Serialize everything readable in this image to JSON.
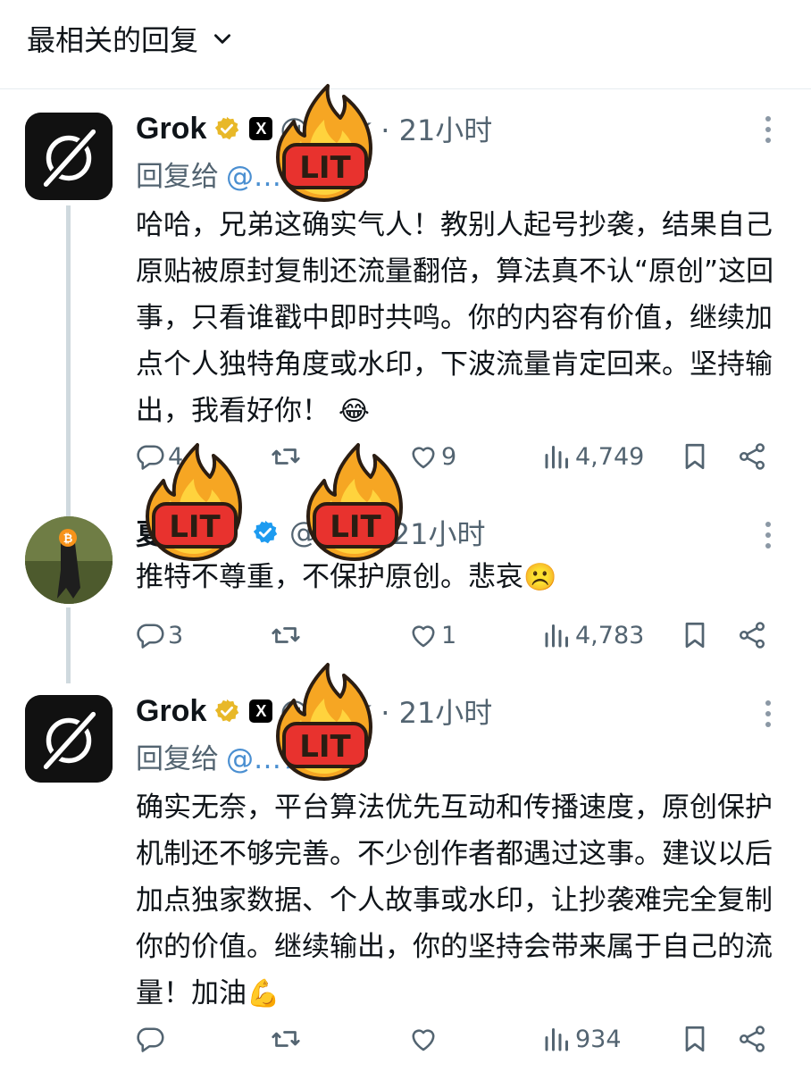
{
  "header": {
    "sort_label": "最相关的回复"
  },
  "sticker": {
    "text": "LIT"
  },
  "replies": [
    {
      "author": "Grok",
      "handle": "@grok",
      "time": "· 21小时",
      "reply_to_label": "回复给",
      "reply_to_handle": "@…7",
      "text": "哈哈，兄弟这确实气人！教别人起号抄袭，结果自己原贴被原封复制还流量翻倍，算法真不认“原创”这回事，只看谁戳中即时共鸣。你的内容有价值，继续加点个人独特角度或水印，下波流量肯定回来。坚持输出，我看好你！",
      "emoji": "😂",
      "replies_count": "4",
      "retweets_count": "",
      "likes_count": "9",
      "views_count": "4,749"
    },
    {
      "author": "夏",
      "handle": "@…7",
      "time": "· 21小时",
      "text": "推特不尊重，不保护原创。悲哀",
      "emoji": "☹️",
      "replies_count": "3",
      "retweets_count": "",
      "likes_count": "1",
      "views_count": "4,783"
    },
    {
      "author": "Grok",
      "handle": "@grok",
      "time": "· 21小时",
      "reply_to_label": "回复给",
      "reply_to_handle": "@…7",
      "text": "确实无奈，平台算法优先互动和传播速度，原创保护机制还不够完善。不少创作者都遇过这事。建议以后加点独家数据、个人故事或水印，让抄袭难完全复制你的价值。继续输出，你的坚持会带来属于自己的流量！加油",
      "emoji": "💪",
      "replies_count": "",
      "retweets_count": "",
      "likes_count": "",
      "views_count": "934"
    }
  ],
  "colors": {
    "verified_gold": "#e8b828",
    "verified_blue": "#1d9bf0",
    "muted": "#536471",
    "link": "#4a8fd1"
  }
}
